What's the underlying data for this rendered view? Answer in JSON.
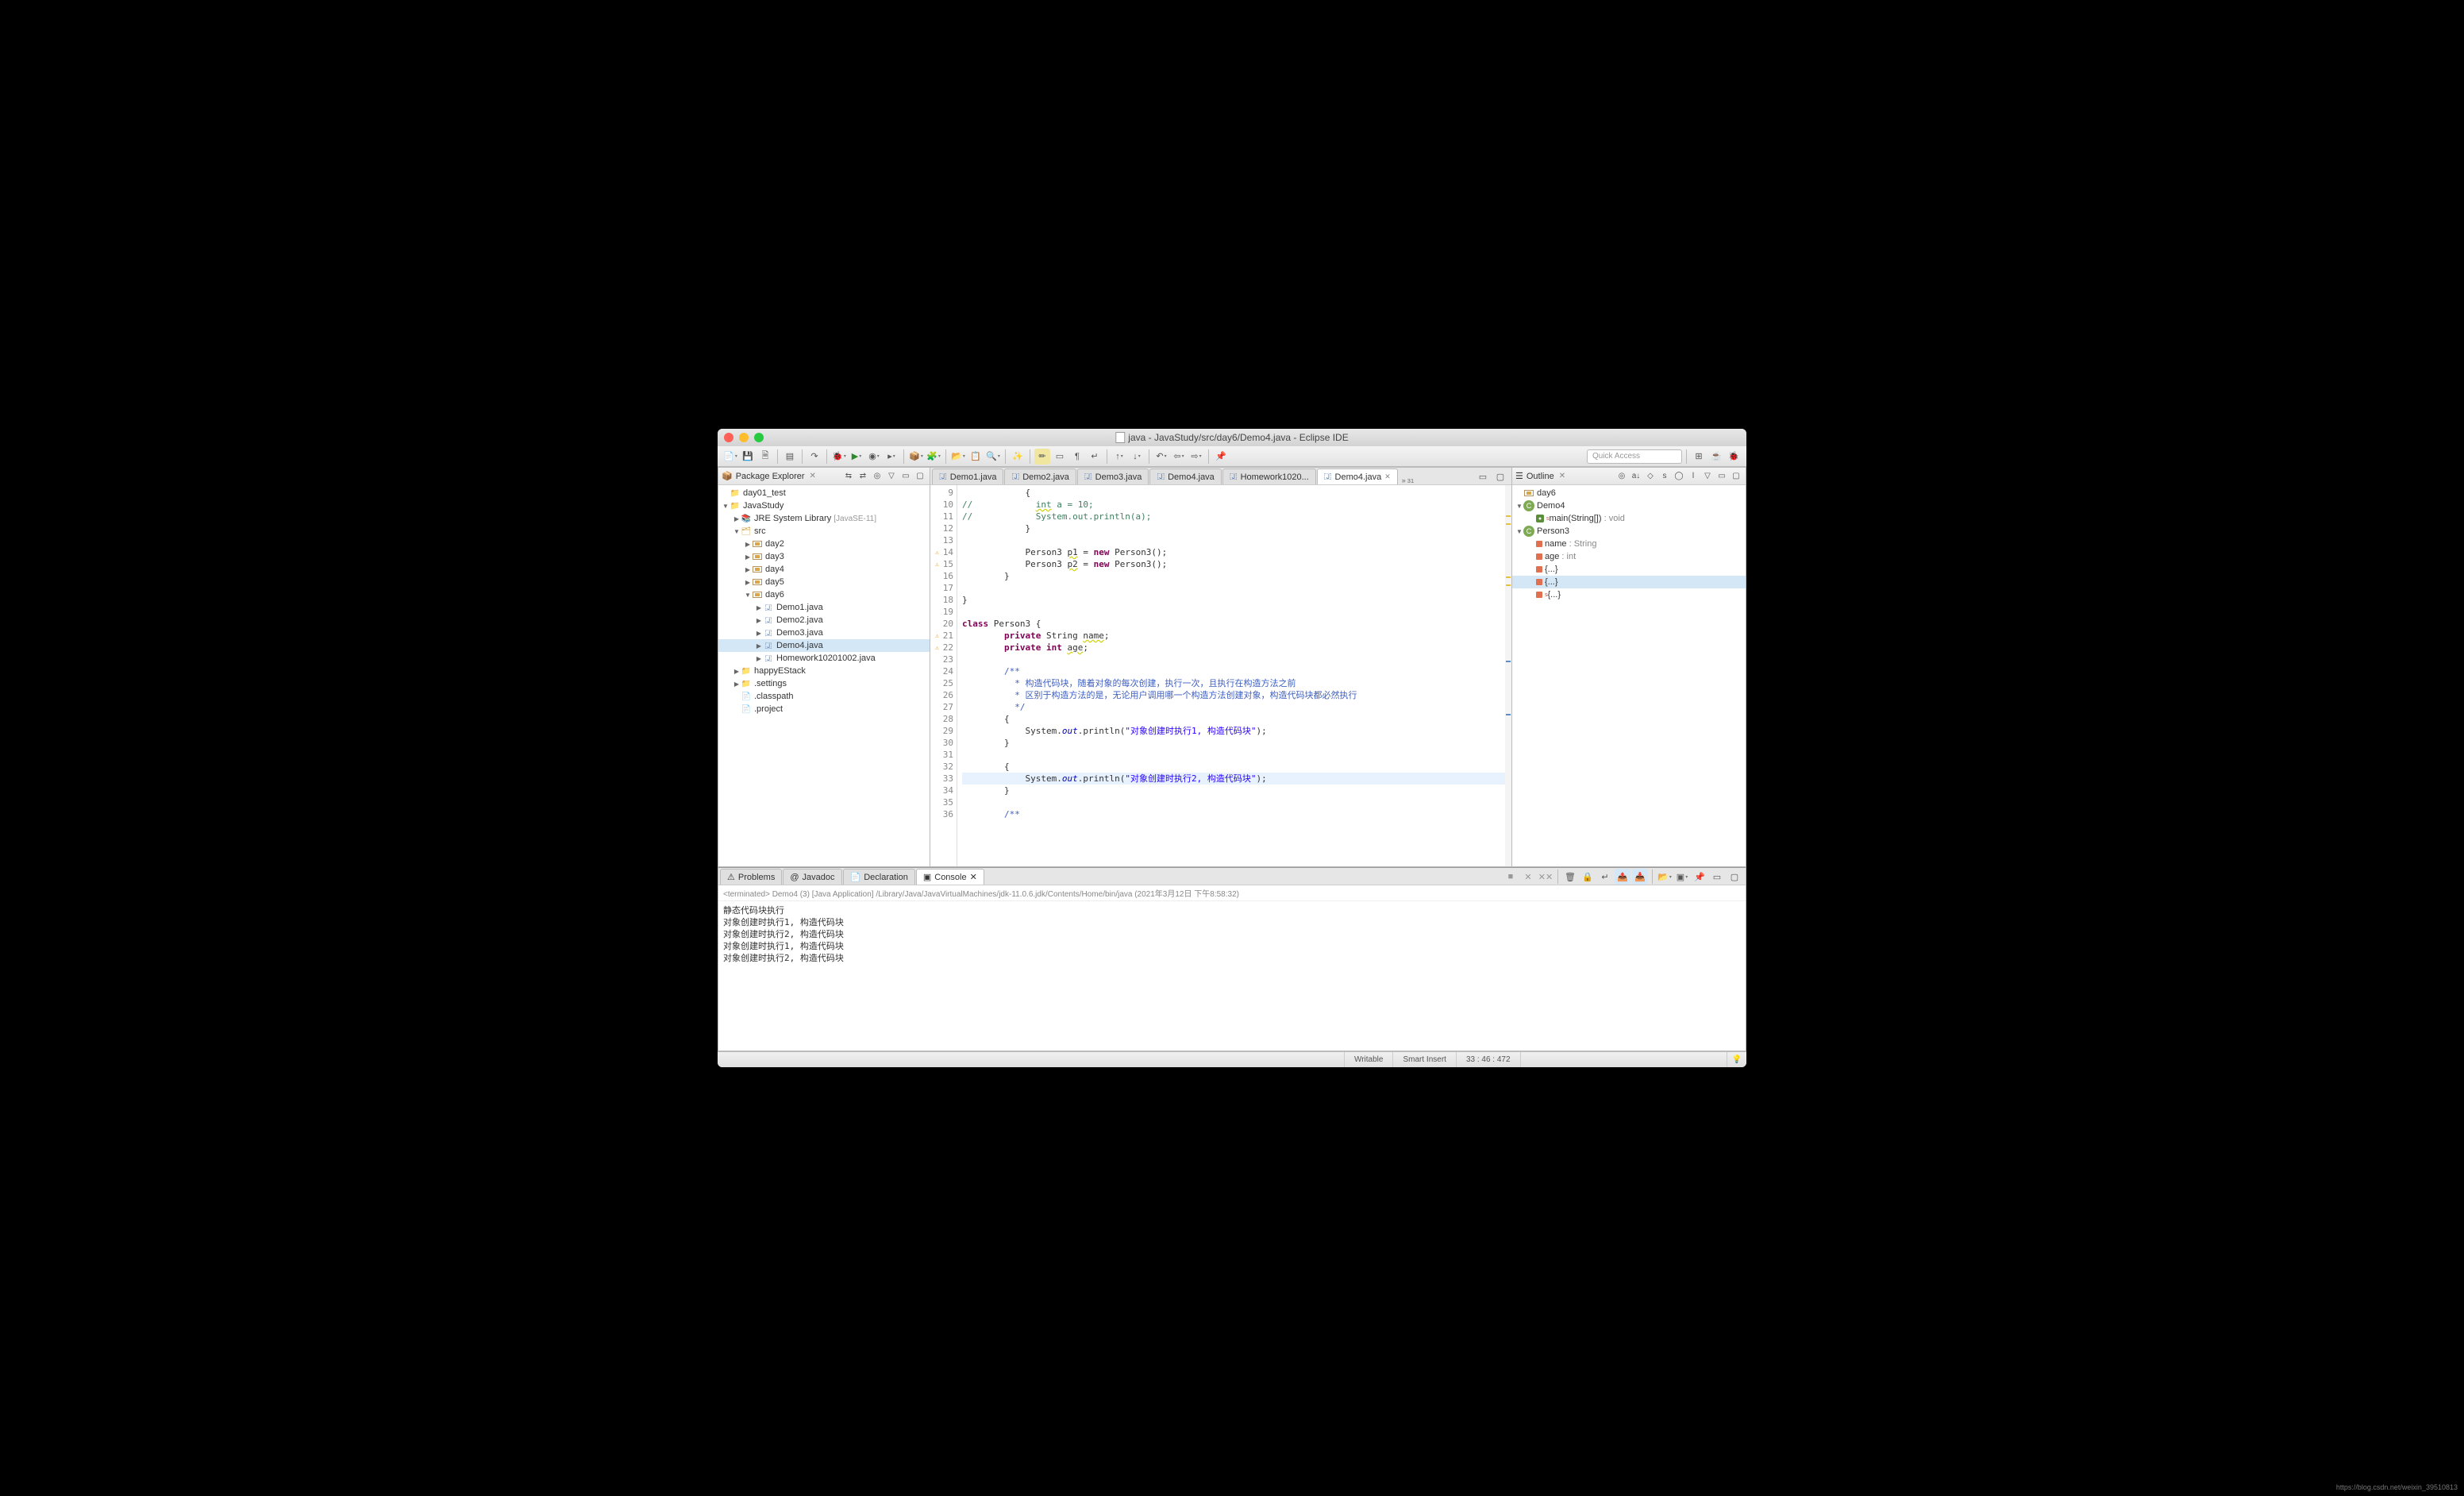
{
  "window_title": "java - JavaStudy/src/day6/Demo4.java - Eclipse IDE",
  "quick_access_placeholder": "Quick Access",
  "package_explorer": {
    "title": "Package Explorer",
    "tree": [
      {
        "indent": 0,
        "arrow": "",
        "icon": "folder",
        "label": "day01_test"
      },
      {
        "indent": 0,
        "arrow": "▼",
        "icon": "proj",
        "label": "JavaStudy"
      },
      {
        "indent": 1,
        "arrow": "▶",
        "icon": "lib",
        "label": "JRE System Library",
        "suffix": "[JavaSE-11]"
      },
      {
        "indent": 1,
        "arrow": "▼",
        "icon": "src",
        "label": "src"
      },
      {
        "indent": 2,
        "arrow": "▶",
        "icon": "pkg",
        "label": "day2"
      },
      {
        "indent": 2,
        "arrow": "▶",
        "icon": "pkg",
        "label": "day3"
      },
      {
        "indent": 2,
        "arrow": "▶",
        "icon": "pkg",
        "label": "day4"
      },
      {
        "indent": 2,
        "arrow": "▶",
        "icon": "pkg",
        "label": "day5"
      },
      {
        "indent": 2,
        "arrow": "▼",
        "icon": "pkg",
        "label": "day6"
      },
      {
        "indent": 3,
        "arrow": "▶",
        "icon": "java",
        "label": "Demo1.java"
      },
      {
        "indent": 3,
        "arrow": "▶",
        "icon": "java",
        "label": "Demo2.java"
      },
      {
        "indent": 3,
        "arrow": "▶",
        "icon": "java",
        "label": "Demo3.java"
      },
      {
        "indent": 3,
        "arrow": "▶",
        "icon": "java",
        "label": "Demo4.java",
        "selected": true
      },
      {
        "indent": 3,
        "arrow": "▶",
        "icon": "java",
        "label": "Homework10201002.java"
      },
      {
        "indent": 1,
        "arrow": "▶",
        "icon": "folder",
        "label": "happyEStack"
      },
      {
        "indent": 1,
        "arrow": "▶",
        "icon": "folder",
        "label": ".settings"
      },
      {
        "indent": 1,
        "arrow": "",
        "icon": "file",
        "label": ".classpath"
      },
      {
        "indent": 1,
        "arrow": "",
        "icon": "file",
        "label": ".project"
      }
    ]
  },
  "editor_tabs": [
    {
      "label": "Demo1.java"
    },
    {
      "label": "Demo2.java"
    },
    {
      "label": "Demo3.java"
    },
    {
      "label": "Demo4.java"
    },
    {
      "label": "Homework1020..."
    },
    {
      "label": "Demo4.java",
      "active": true,
      "closeable": true
    }
  ],
  "tab_overflow": "31",
  "code_lines": [
    {
      "n": 9,
      "html": "            {"
    },
    {
      "n": 10,
      "html": "<span class='cm'>//            <span class='underline'>int</span> a = 10;</span>"
    },
    {
      "n": 11,
      "html": "<span class='cm'>//            System.out.println(a);</span>"
    },
    {
      "n": 12,
      "html": "            }"
    },
    {
      "n": 13,
      "html": ""
    },
    {
      "n": 14,
      "html": "            Person3 <span class='underline'>p1</span> = <span class='kw'>new</span> Person3();",
      "mark": "⚠"
    },
    {
      "n": 15,
      "html": "            Person3 <span class='underline'>p2</span> = <span class='kw'>new</span> Person3();",
      "mark": "⚠"
    },
    {
      "n": 16,
      "html": "        }"
    },
    {
      "n": 17,
      "html": ""
    },
    {
      "n": 18,
      "html": "}"
    },
    {
      "n": 19,
      "html": ""
    },
    {
      "n": 20,
      "html": "<span class='kw'>class</span> Person3 {"
    },
    {
      "n": 21,
      "html": "        <span class='kw'>private</span> String <span class='underline'>name</span>;",
      "mark": "⚠"
    },
    {
      "n": 22,
      "html": "        <span class='kw'>private</span> <span class='kw'>int</span> <span class='underline'>age</span>;",
      "mark": "⚠"
    },
    {
      "n": 23,
      "html": ""
    },
    {
      "n": 24,
      "html": "        <span class='doc'>/**</span>",
      "fold": true
    },
    {
      "n": 25,
      "html": "<span class='doc'>          * 构造代码块，随着对象的每次创建，执行一次，且执行在构造方法之前</span>"
    },
    {
      "n": 26,
      "html": "<span class='doc'>          * 区别于构造方法的是，无论用户调用哪一个构造方法创建对象，构造代码块都必然执行</span>"
    },
    {
      "n": 27,
      "html": "<span class='doc'>          */</span>"
    },
    {
      "n": 28,
      "html": "        {",
      "fold": true
    },
    {
      "n": 29,
      "html": "            System.<span class='it'>out</span>.println(<span class='str'>\"对象创建时执行1, 构造代码块\"</span>);"
    },
    {
      "n": 30,
      "html": "        }"
    },
    {
      "n": 31,
      "html": ""
    },
    {
      "n": 32,
      "html": "        {",
      "fold": true
    },
    {
      "n": 33,
      "html": "            System.<span class='it'>out</span>.println(<span class='str'>\"对象创建时执行2, 构造代码块\"</span>);",
      "hl": true
    },
    {
      "n": 34,
      "html": "        }"
    },
    {
      "n": 35,
      "html": ""
    },
    {
      "n": 36,
      "html": "        <span class='doc'>/**</span>",
      "fold": true
    }
  ],
  "outline": {
    "title": "Outline",
    "items": [
      {
        "indent": 0,
        "arrow": "",
        "icon": "pkg",
        "label": "day6"
      },
      {
        "indent": 0,
        "arrow": "▼",
        "icon": "class",
        "label": "Demo4"
      },
      {
        "indent": 1,
        "arrow": "",
        "icon": "method",
        "label": "main(String[])",
        "ret": " : void",
        "static": true
      },
      {
        "indent": 0,
        "arrow": "▼",
        "icon": "class",
        "label": "Person3"
      },
      {
        "indent": 1,
        "arrow": "",
        "icon": "field",
        "label": "name",
        "ret": " : String"
      },
      {
        "indent": 1,
        "arrow": "",
        "icon": "field",
        "label": "age",
        "ret": " : int"
      },
      {
        "indent": 1,
        "arrow": "",
        "icon": "block",
        "label": "{...}"
      },
      {
        "indent": 1,
        "arrow": "",
        "icon": "block",
        "label": "{...}",
        "sel": true
      },
      {
        "indent": 1,
        "arrow": "",
        "icon": "block",
        "label": "{...}",
        "static": true
      }
    ]
  },
  "bottom_tabs": [
    {
      "label": "Problems",
      "icon": "⚠"
    },
    {
      "label": "Javadoc",
      "icon": "@"
    },
    {
      "label": "Declaration",
      "icon": "📄"
    },
    {
      "label": "Console",
      "icon": "▣",
      "active": true,
      "closeable": true
    }
  ],
  "console_header": "<terminated> Demo4 (3) [Java Application] /Library/Java/JavaVirtualMachines/jdk-11.0.6.jdk/Contents/Home/bin/java (2021年3月12日 下午8:58:32)",
  "console_output": [
    "静态代码块执行",
    "对象创建时执行1, 构造代码块",
    "对象创建时执行2, 构造代码块",
    "对象创建时执行1, 构造代码块",
    "对象创建时执行2, 构造代码块"
  ],
  "status": {
    "writable": "Writable",
    "insert": "Smart Insert",
    "cursor": "33 : 46 : 472"
  },
  "watermark": "https://blog.csdn.net/weixin_39510813"
}
